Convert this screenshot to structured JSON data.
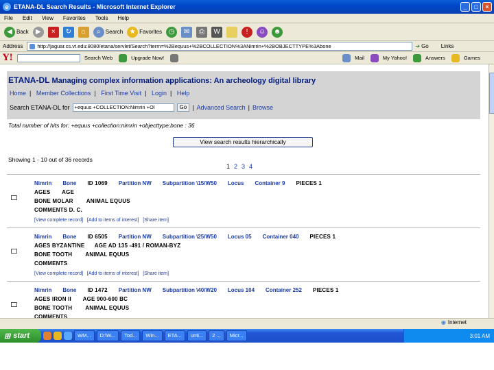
{
  "window": {
    "title": "ETANA-DL Search Results - Microsoft Internet Explorer",
    "controls": [
      "_",
      "□",
      "×"
    ]
  },
  "menu": [
    "File",
    "Edit",
    "View",
    "Favorites",
    "Tools",
    "Help"
  ],
  "toolbar": {
    "back": "Back",
    "search": "Search",
    "favorites": "Favorites"
  },
  "address": {
    "label": "Address",
    "url": "http://jaguar.cs.vt.edu:8080/etana/servlet/Search?term=%2Bequus+%2BCOLLECTION%3ANimrin+%2BOBJECTTYPE%3Abone",
    "go": "Go",
    "links": "Links"
  },
  "yahoo": {
    "logo": "Y!",
    "search_web": "Search Web",
    "upgrade": "Upgrade Now!",
    "mail": "Mail",
    "my_yahoo": "My Yahoo!",
    "answers": "Answers",
    "games": "Games"
  },
  "page": {
    "brand": "ETANA-DL",
    "tagline": "Managing complex information applications: An archeology digital library",
    "nav": [
      "Home",
      "Member Collections",
      "First Time Visit",
      "Login",
      "Help"
    ],
    "search_label": "Search ETANA-DL for",
    "search_value": "+equus +COLLECTION:Nimrin +Ol",
    "go": "Go",
    "advanced": "Advanced Search",
    "browse": "Browse",
    "total": "Total number of hits for: +equus +collection:nimrin +objecttype:bone : 36",
    "hier_button": "View search results hierarchically",
    "showing": "Showing 1 - 10 out of 36 records",
    "pages": [
      "1",
      "2",
      "3",
      "4"
    ]
  },
  "records": [
    {
      "l1": [
        [
          "Nimrin",
          "b"
        ],
        [
          "Bone",
          "b"
        ],
        [
          "ID 1069",
          "k"
        ],
        [
          "Partition NW",
          "b"
        ],
        [
          "Subpartition \\15/W50",
          "b"
        ],
        [
          "Locus",
          "b"
        ],
        [
          "Container 9",
          "b"
        ],
        [
          "PIECES 1",
          "k"
        ]
      ],
      "l2": "AGES       AGE",
      "l3": "BONE MOLAR        ANIMAL EQUUS",
      "l4": "COMMENTS D. C.",
      "links": "[View complete record]   [Add to items of interest]   [Share item]"
    },
    {
      "l1": [
        [
          "Nimrin",
          "b"
        ],
        [
          "Bone",
          "b"
        ],
        [
          "ID 6505",
          "k"
        ],
        [
          "Partition NW",
          "b"
        ],
        [
          "Subpartition \\25/W50",
          "b"
        ],
        [
          "Locus 05",
          "b"
        ],
        [
          "Container 040",
          "b"
        ],
        [
          "PIECES 1",
          "k"
        ]
      ],
      "l2": "AGES BYZANTINE      AGE AD 135 -491 / ROMAN-BYZ",
      "l3": "BONE TOOTH        ANIMAL EQUUS",
      "l4": "COMMENTS",
      "links": "[View complete record]   [Add to items of interest]   [Share item]"
    },
    {
      "l1": [
        [
          "Nimrin",
          "b"
        ],
        [
          "Bone",
          "b"
        ],
        [
          "ID 1472",
          "k"
        ],
        [
          "Partition NW",
          "b"
        ],
        [
          "Subpartition \\40/W20",
          "b"
        ],
        [
          "Locus 104",
          "b"
        ],
        [
          "Container 252",
          "b"
        ],
        [
          "PIECES 1",
          "k"
        ]
      ],
      "l2": "AGES IRON II       AGE 900-600 BC",
      "l3": "BONE TOOTH        ANIMAL EQUUS",
      "l4": "COMMENTS",
      "links": ""
    }
  ],
  "status": {
    "zone": "Internet"
  },
  "taskbar": {
    "start": "start",
    "tasks": [
      "WM...",
      "D:\\W...",
      "Tod...",
      "Win...",
      "ETA...",
      "unti...",
      "2 ...",
      "Micr..."
    ],
    "clock": "3:01 AM"
  }
}
